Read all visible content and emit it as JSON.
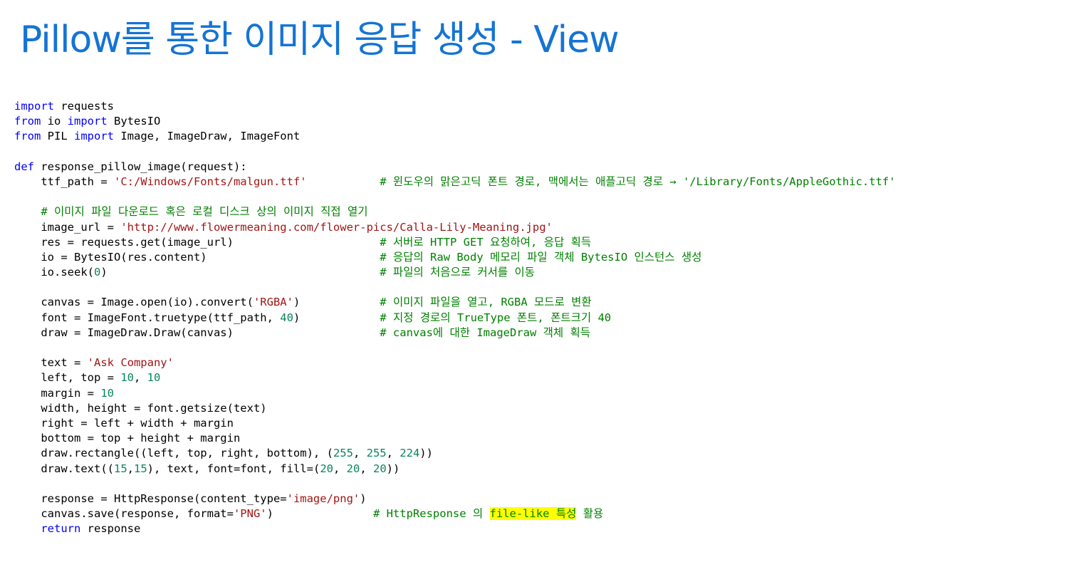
{
  "title": "Pillow를 통한 이미지 응답 생성 - View",
  "code": {
    "lines": [
      [
        {
          "t": "import",
          "c": "kw"
        },
        {
          "t": " requests"
        }
      ],
      [
        {
          "t": "from",
          "c": "kw"
        },
        {
          "t": " io "
        },
        {
          "t": "import",
          "c": "kw"
        },
        {
          "t": " BytesIO"
        }
      ],
      [
        {
          "t": "from",
          "c": "kw"
        },
        {
          "t": " PIL "
        },
        {
          "t": "import",
          "c": "kw"
        },
        {
          "t": " Image, ImageDraw, ImageFont"
        }
      ],
      [],
      [
        {
          "t": "def",
          "c": "kw"
        },
        {
          "t": " response_pillow_image(request):"
        }
      ],
      [
        {
          "t": "    ttf_path = "
        },
        {
          "t": "'C:/Windows/Fonts/malgun.ttf'",
          "c": "str"
        },
        {
          "t": "           "
        },
        {
          "t": "# 윈도우의 맑은고딕 폰트 경로, 맥에서는 애플고딕 경로 → '/Library/Fonts/AppleGothic.ttf'",
          "c": "com"
        }
      ],
      [],
      [
        {
          "t": "    "
        },
        {
          "t": "# 이미지 파일 다운로드 혹은 로컬 디스크 상의 이미지 직접 열기",
          "c": "com"
        }
      ],
      [
        {
          "t": "    image_url = "
        },
        {
          "t": "'http://www.flowermeaning.com/flower-pics/Calla-Lily-Meaning.jpg'",
          "c": "str"
        }
      ],
      [
        {
          "t": "    res = requests.get(image_url)                      "
        },
        {
          "t": "# 서버로 HTTP GET 요청하여, 응답 획득",
          "c": "com"
        }
      ],
      [
        {
          "t": "    io = BytesIO(res.content)                          "
        },
        {
          "t": "# 응답의 Raw Body 메모리 파일 객체 BytesIO 인스턴스 생성",
          "c": "com"
        }
      ],
      [
        {
          "t": "    io.seek("
        },
        {
          "t": "0",
          "c": "num"
        },
        {
          "t": ")                                         "
        },
        {
          "t": "# 파일의 처음으로 커서를 이동",
          "c": "com"
        }
      ],
      [],
      [
        {
          "t": "    canvas = Image.open(io).convert("
        },
        {
          "t": "'RGBA'",
          "c": "str"
        },
        {
          "t": ")            "
        },
        {
          "t": "# 이미지 파일을 열고, RGBA 모드로 변환",
          "c": "com"
        }
      ],
      [
        {
          "t": "    font = ImageFont.truetype(ttf_path, "
        },
        {
          "t": "40",
          "c": "num"
        },
        {
          "t": ")            "
        },
        {
          "t": "# 지정 경로의 TrueType 폰트, 폰트크기 40",
          "c": "com"
        }
      ],
      [
        {
          "t": "    draw = ImageDraw.Draw(canvas)                      "
        },
        {
          "t": "# canvas에 대한 ImageDraw 객체 획득",
          "c": "com"
        }
      ],
      [],
      [
        {
          "t": "    text = "
        },
        {
          "t": "'Ask Company'",
          "c": "str"
        }
      ],
      [
        {
          "t": "    left, top = "
        },
        {
          "t": "10",
          "c": "num"
        },
        {
          "t": ", "
        },
        {
          "t": "10",
          "c": "num"
        }
      ],
      [
        {
          "t": "    margin = "
        },
        {
          "t": "10",
          "c": "num"
        }
      ],
      [
        {
          "t": "    width, height = font.getsize(text)"
        }
      ],
      [
        {
          "t": "    right = left + width + margin"
        }
      ],
      [
        {
          "t": "    bottom = top + height + margin"
        }
      ],
      [
        {
          "t": "    draw.rectangle((left, top, right, bottom), ("
        },
        {
          "t": "255",
          "c": "num"
        },
        {
          "t": ", "
        },
        {
          "t": "255",
          "c": "num"
        },
        {
          "t": ", "
        },
        {
          "t": "224",
          "c": "num"
        },
        {
          "t": "))"
        }
      ],
      [
        {
          "t": "    draw.text(("
        },
        {
          "t": "15",
          "c": "num"
        },
        {
          "t": ","
        },
        {
          "t": "15",
          "c": "num"
        },
        {
          "t": "), text, font=font, fill=("
        },
        {
          "t": "20",
          "c": "num"
        },
        {
          "t": ", "
        },
        {
          "t": "20",
          "c": "num"
        },
        {
          "t": ", "
        },
        {
          "t": "20",
          "c": "num"
        },
        {
          "t": "))"
        }
      ],
      [],
      [
        {
          "t": "    response = HttpResponse(content_type="
        },
        {
          "t": "'image/png'",
          "c": "str"
        },
        {
          "t": ")"
        }
      ],
      [
        {
          "t": "    canvas.save(response, format="
        },
        {
          "t": "'PNG'",
          "c": "str"
        },
        {
          "t": ")               "
        },
        {
          "t": "# HttpResponse 의 ",
          "c": "com"
        },
        {
          "t": "file-like 특성",
          "c": "com hl"
        },
        {
          "t": " 활용",
          "c": "com"
        }
      ],
      [
        {
          "t": "    "
        },
        {
          "t": "return",
          "c": "kw"
        },
        {
          "t": " response"
        }
      ]
    ]
  }
}
